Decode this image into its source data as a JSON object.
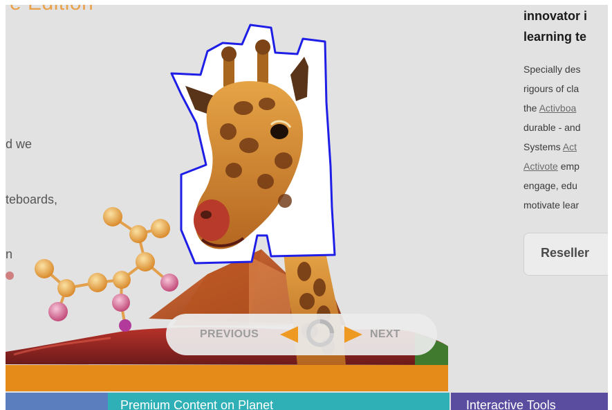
{
  "banner": {
    "edition_text": "e Edition",
    "fragments": [
      "d we",
      "teboards,",
      "n"
    ]
  },
  "carousel": {
    "previous_label": "PREVIOUS",
    "next_label": "NEXT"
  },
  "tabs": [
    {
      "label": ""
    },
    {
      "label": "Premium Content on Planet"
    },
    {
      "label": "Interactive Tools"
    }
  ],
  "sidebar": {
    "heading_line1": "innovator i",
    "heading_line2": "learning te",
    "para_line1": "Specially des",
    "para_line2": "rigours of cla",
    "para_line3_prefix": "the ",
    "para_line3_link": "Activboa",
    "para_line4": "durable - and",
    "para_line5_prefix": "Systems ",
    "para_line5_link": "Act",
    "para_line6_link": "Activote",
    "para_line6_suffix": " emp",
    "para_line7": "engage, edu",
    "para_line8": "motivate lear",
    "reseller_label": "Reseller"
  },
  "colors": {
    "accent_orange": "#e48b1a",
    "outline_blue": "#1e1ee6",
    "tab_teal": "#2fb0b6",
    "tab_purple": "#5a4da0",
    "tab_blue": "#5b7fbe"
  },
  "icons": [
    "giraffe-image",
    "molecule-graphic",
    "pyramid-graphic",
    "arrow-left-icon",
    "arrow-right-icon",
    "loading-spinner-icon"
  ]
}
